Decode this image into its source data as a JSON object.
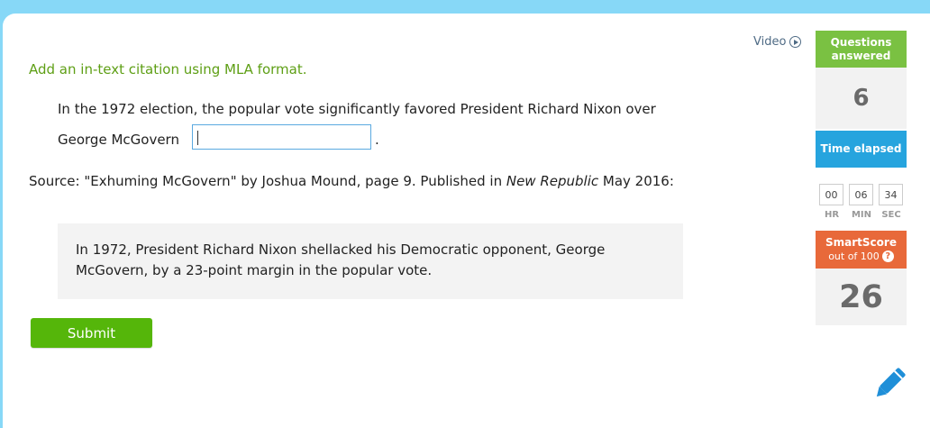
{
  "question": {
    "instruction": "Add an in-text citation using MLA format.",
    "sentence_line1": "In the 1972 election, the popular vote significantly favored President Richard Nixon over",
    "sentence_line2": "George McGovern",
    "period": ".",
    "citation_value": "",
    "source_prefix": "Source: \"Exhuming McGovern\" by Joshua Mound, page 9. Published in ",
    "source_publication": "New Republic",
    "source_suffix": " May 2016:",
    "quote": "In 1972, President Richard Nixon shellacked his Democratic opponent, George McGovern, by a 23-point margin in the popular vote.",
    "submit_label": "Submit"
  },
  "video_label": "Video",
  "sidebar": {
    "questions_answered_label": "Questions answered",
    "questions_answered_value": "6",
    "time_elapsed_label": "Time elapsed",
    "timer": {
      "hr": "00",
      "min": "06",
      "sec": "34"
    },
    "timer_labels": {
      "hr": "HR",
      "min": "MIN",
      "sec": "SEC"
    },
    "smartscore_label": "SmartScore",
    "smartscore_sub": "out of 100",
    "smartscore_value": "26"
  },
  "colors": {
    "background": "#87d8f7",
    "instruction_green": "#5e9f15",
    "submit_green": "#55b60a",
    "questions_green": "#7ac142",
    "time_blue": "#26a4de",
    "smartscore_orange": "#e8693a",
    "pencil_blue": "#1f8fd8"
  }
}
